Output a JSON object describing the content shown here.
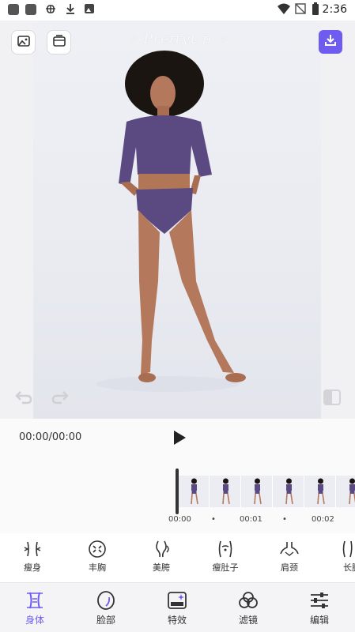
{
  "status_bar": {
    "time": "2:36",
    "icons": [
      "notification-square-icon",
      "notification-square-icon",
      "bug-icon",
      "download-arrow-icon",
      "image-notification-icon",
      "wifi-icon",
      "no-signal-icon",
      "battery-icon"
    ]
  },
  "preview": {
    "watermark": "✧ PrettyUp ✧",
    "icons": {
      "gallery": "image-icon",
      "album": "album-icon",
      "download": "download-icon",
      "undo": "undo-icon",
      "redo": "redo-icon",
      "compare": "compare-icon"
    },
    "accent": "#6e5cf0"
  },
  "playback": {
    "timecode": "00:00/00:00",
    "ticks": [
      "00:00",
      "•",
      "00:01",
      "•",
      "00:02"
    ]
  },
  "tools": [
    {
      "label": "瘦身",
      "icon": "slim-body-icon"
    },
    {
      "label": "丰胸",
      "icon": "enhance-chest-icon"
    },
    {
      "label": "美胯",
      "icon": "hip-icon"
    },
    {
      "label": "瘦肚子",
      "icon": "slim-belly-icon"
    },
    {
      "label": "肩颈",
      "icon": "shoulder-neck-icon"
    },
    {
      "label": "长腿",
      "icon": "long-legs-icon"
    }
  ],
  "nav": [
    {
      "label": "身体",
      "icon": "body-icon",
      "active": true
    },
    {
      "label": "脸部",
      "icon": "face-icon",
      "active": false
    },
    {
      "label": "特效",
      "icon": "effects-icon",
      "active": false
    },
    {
      "label": "滤镜",
      "icon": "filter-icon",
      "active": false
    },
    {
      "label": "编辑",
      "icon": "edit-icon",
      "active": false
    }
  ]
}
